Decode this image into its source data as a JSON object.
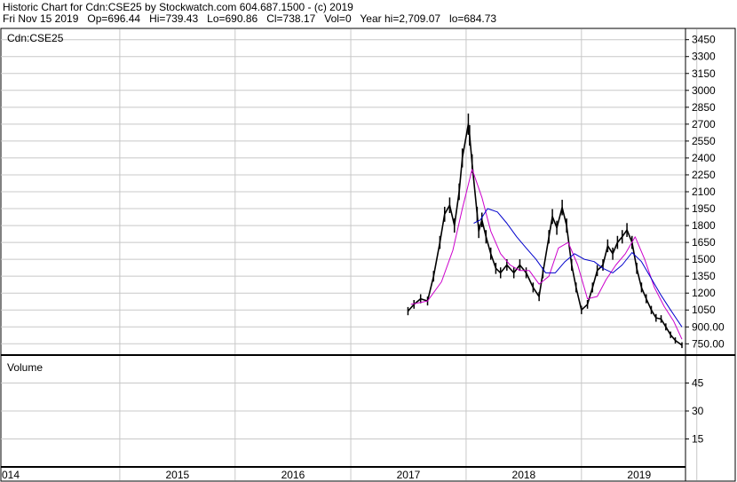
{
  "header": {
    "line1": "Historic Chart for Cdn:CSE25 by Stockwatch.com 604.687.1500 - (c) 2019",
    "line2": "Fri Nov 15 2019   Op=696.44   Hi=739.43   Lo=690.86   Cl=738.17   Vol=0   Year hi=2,709.07   lo=684.73"
  },
  "chart_data": [
    {
      "type": "line",
      "panel": "price",
      "title": "Cdn:CSE25",
      "x_axis": {
        "labels": [
          "014",
          "2015",
          "2016",
          "2017",
          "2018",
          "2019"
        ],
        "range": [
          "2014-01-01",
          "2019-11-15"
        ]
      },
      "y_axis": {
        "side": "right",
        "ticks": [
          "3450",
          "3300",
          "3150",
          "3000",
          "2850",
          "2700",
          "2550",
          "2400",
          "2250",
          "2100",
          "1950",
          "1800",
          "1650",
          "1500",
          "1350",
          "1200",
          "1050",
          "900.00",
          "750.00"
        ],
        "ylim": [
          650,
          3550
        ]
      },
      "grid": true,
      "series": [
        {
          "role": "price",
          "color": "#000000",
          "x": [
            "2017-07-01",
            "2017-07-20",
            "2017-08-10",
            "2017-09-01",
            "2017-09-20",
            "2017-10-10",
            "2017-10-25",
            "2017-11-10",
            "2017-11-25",
            "2017-12-10",
            "2017-12-20",
            "2018-01-08",
            "2018-01-12",
            "2018-01-20",
            "2018-02-05",
            "2018-02-10",
            "2018-02-20",
            "2018-03-05",
            "2018-03-20",
            "2018-04-05",
            "2018-04-20",
            "2018-05-10",
            "2018-06-01",
            "2018-06-20",
            "2018-07-10",
            "2018-08-01",
            "2018-08-20",
            "2018-09-01",
            "2018-09-20",
            "2018-10-01",
            "2018-10-15",
            "2018-11-01",
            "2018-11-15",
            "2018-12-01",
            "2018-12-15",
            "2019-01-01",
            "2019-01-20",
            "2019-02-05",
            "2019-02-20",
            "2019-03-10",
            "2019-03-25",
            "2019-04-10",
            "2019-04-25",
            "2019-05-10",
            "2019-05-25",
            "2019-06-10",
            "2019-06-25",
            "2019-07-10",
            "2019-07-25",
            "2019-08-10",
            "2019-08-25",
            "2019-09-10",
            "2019-09-25",
            "2019-10-10",
            "2019-10-25",
            "2019-11-15"
          ],
          "values": [
            1040,
            1100,
            1150,
            1130,
            1350,
            1650,
            1900,
            1980,
            1800,
            2100,
            2400,
            2700,
            2600,
            2350,
            1900,
            1750,
            1850,
            1700,
            1550,
            1420,
            1380,
            1450,
            1380,
            1450,
            1380,
            1250,
            1170,
            1380,
            1700,
            1880,
            1780,
            1960,
            1800,
            1450,
            1250,
            1050,
            1100,
            1250,
            1400,
            1450,
            1620,
            1550,
            1650,
            1700,
            1760,
            1650,
            1420,
            1250,
            1150,
            1050,
            980,
            970,
            900,
            830,
            780,
            738
          ]
        },
        {
          "role": "moving-average-1",
          "color": "#cc00cc",
          "x": [
            "2017-07-10",
            "2017-09-01",
            "2017-10-15",
            "2017-11-20",
            "2017-12-20",
            "2018-01-20",
            "2018-02-20",
            "2018-03-20",
            "2018-04-20",
            "2018-05-20",
            "2018-06-20",
            "2018-07-20",
            "2018-08-20",
            "2018-09-20",
            "2018-10-20",
            "2018-11-20",
            "2018-12-20",
            "2019-01-20",
            "2019-02-20",
            "2019-03-20",
            "2019-04-20",
            "2019-05-20",
            "2019-06-20",
            "2019-07-20",
            "2019-08-20",
            "2019-09-20",
            "2019-10-20",
            "2019-11-15"
          ],
          "values": [
            1100,
            1130,
            1300,
            1580,
            1950,
            2300,
            2050,
            1750,
            1550,
            1450,
            1400,
            1400,
            1280,
            1350,
            1600,
            1650,
            1450,
            1150,
            1170,
            1320,
            1450,
            1550,
            1700,
            1500,
            1250,
            1080,
            950,
            790
          ]
        },
        {
          "role": "moving-average-2",
          "color": "#0000cc",
          "x": [
            "2018-01-25",
            "2018-02-15",
            "2018-03-10",
            "2018-04-10",
            "2018-05-10",
            "2018-06-10",
            "2018-07-10",
            "2018-08-10",
            "2018-09-10",
            "2018-10-10",
            "2018-11-10",
            "2018-12-10",
            "2019-01-10",
            "2019-02-10",
            "2019-03-10",
            "2019-04-10",
            "2019-05-10",
            "2019-06-10",
            "2019-07-10",
            "2019-08-10",
            "2019-09-10",
            "2019-10-10",
            "2019-11-15"
          ],
          "values": [
            1820,
            1850,
            1950,
            1920,
            1820,
            1700,
            1600,
            1500,
            1380,
            1380,
            1480,
            1550,
            1500,
            1480,
            1420,
            1380,
            1450,
            1560,
            1480,
            1330,
            1180,
            1050,
            900
          ]
        }
      ]
    },
    {
      "type": "bar",
      "panel": "volume",
      "title": "Volume",
      "y_axis": {
        "side": "right",
        "ticks": [
          "45",
          "30",
          "15"
        ],
        "ylim": [
          0,
          60
        ]
      },
      "grid": true,
      "values": []
    }
  ]
}
